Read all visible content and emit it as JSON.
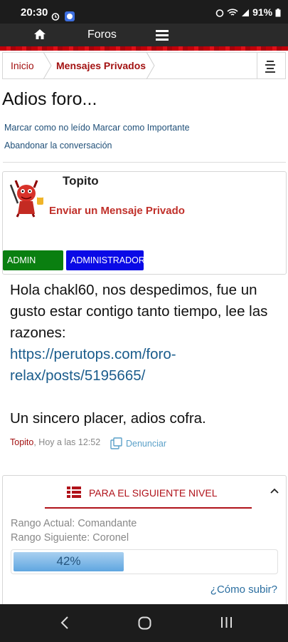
{
  "status_bar": {
    "time": "20:30",
    "battery": "91%"
  },
  "nav": {
    "title": "Foros",
    "home_icon": "home-icon",
    "menu_icon": "hamburger-icon"
  },
  "breadcrumb": {
    "items": [
      "Inicio",
      "Mensajes Privados"
    ]
  },
  "thread": {
    "title": "Adios foro...",
    "actions": {
      "mark_unread": "Marcar como no leído",
      "mark_important": "Marcar como Importante",
      "leave": "Abandonar la conversación"
    }
  },
  "user": {
    "name": "Topito",
    "pm_label": "Enviar un Mensaje Privado",
    "badges": [
      "ADMIN TECH",
      "ADMINISTRADOR"
    ],
    "badge_colors": [
      "#0a7f10",
      "#0a0ae6"
    ]
  },
  "post": {
    "line1": "Hola chakl60, nos despedimos, fue un gusto estar contigo tanto tiempo, lee las razones:",
    "link": "https://perutops.com/foro-relax/posts/5195665/",
    "line2": "Un sincero placer, adios cofra.",
    "author": "Topito",
    "time": ", Hoy a las 12:52",
    "report_label": "Denunciar"
  },
  "rank": {
    "title": "PARA EL SIGUIENTE NIVEL",
    "current": "Rango Actual: Comandante",
    "next": "Rango Siguiente: Coronel",
    "progress": 0.42,
    "progress_label": "42%",
    "howto": "¿Cómo subir?"
  },
  "colors": {
    "accent": "#a31212",
    "link": "#1a5c8c"
  }
}
